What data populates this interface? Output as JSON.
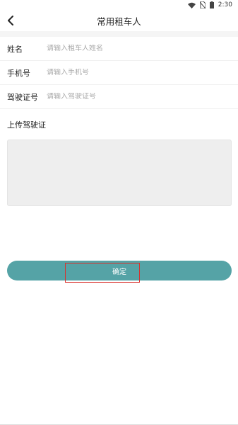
{
  "status_bar": {
    "time": "2:30",
    "icons": [
      "wifi-icon",
      "no-sim-icon",
      "battery-icon"
    ]
  },
  "header": {
    "title": "常用租车人",
    "back_icon": "chevron-left-icon"
  },
  "form": {
    "name": {
      "label": "姓名",
      "placeholder": "请输入租车人姓名",
      "value": ""
    },
    "phone": {
      "label": "手机号",
      "placeholder": "请输入手机号",
      "value": ""
    },
    "license": {
      "label": "驾驶证号",
      "placeholder": "请输入驾驶证号",
      "value": ""
    }
  },
  "upload": {
    "title": "上传驾驶证"
  },
  "actions": {
    "confirm_label": "确定"
  },
  "colors": {
    "accent": "#55a3a6",
    "highlight": "#d9302c",
    "upload_bg": "#eeeeee"
  }
}
